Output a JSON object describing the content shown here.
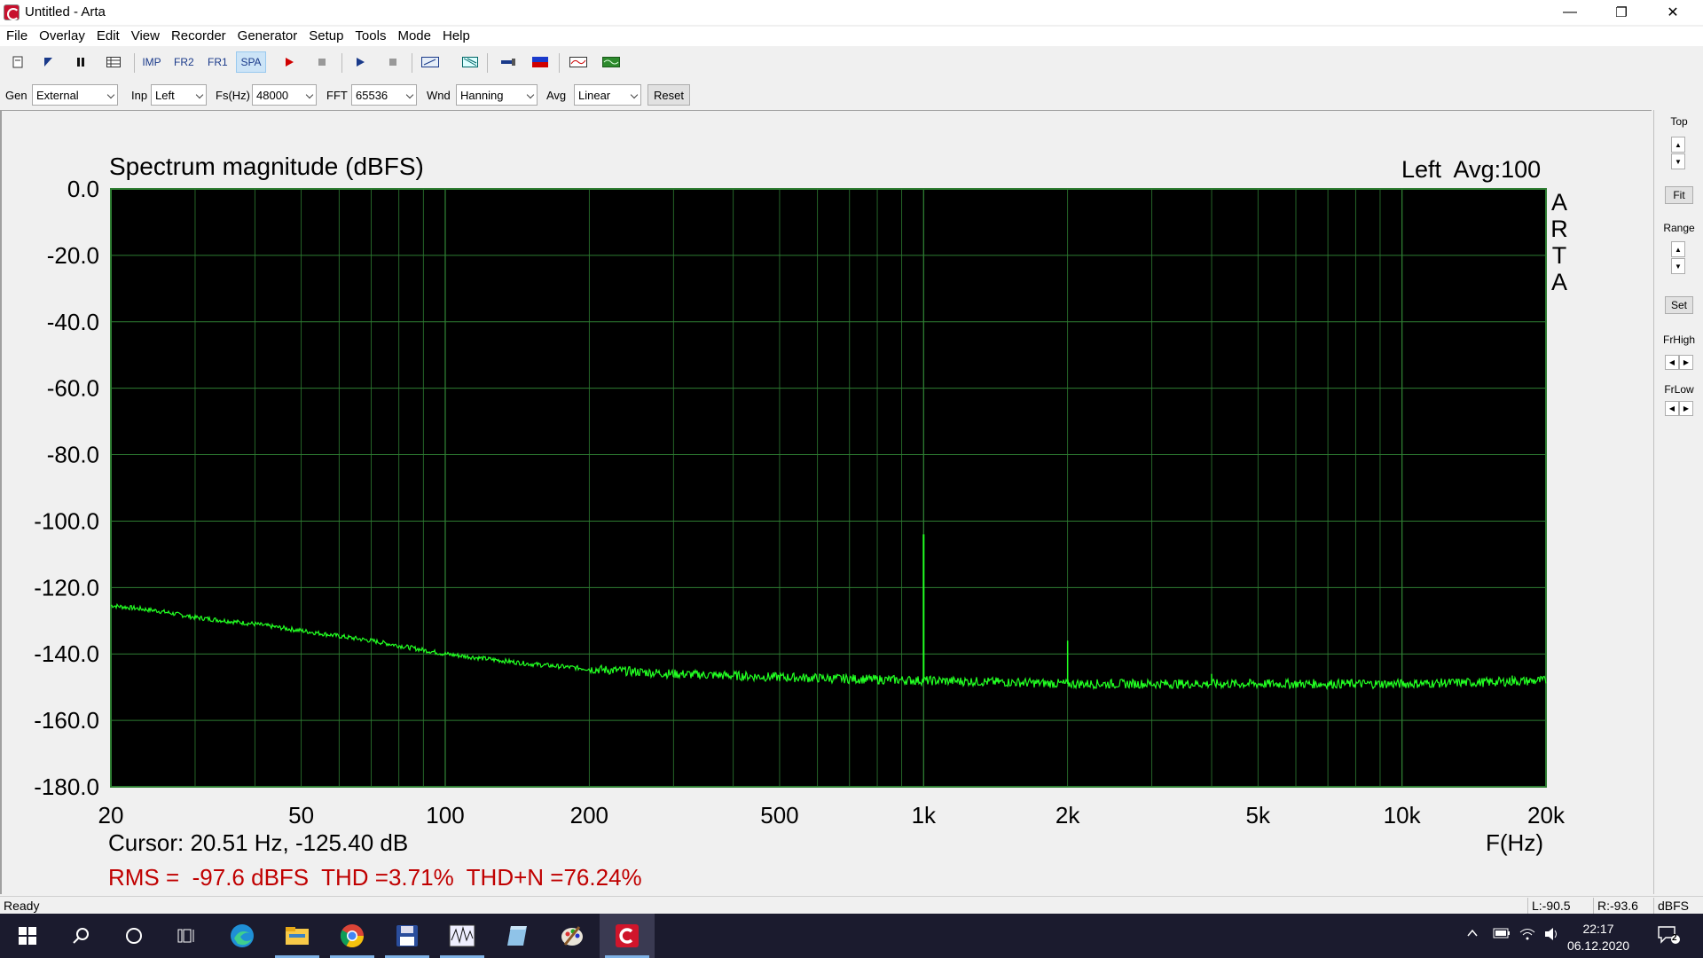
{
  "window": {
    "title": "Untitled - Arta",
    "minimize": "—",
    "restore": "❐",
    "close": "✕"
  },
  "menu": [
    "File",
    "Overlay",
    "Edit",
    "View",
    "Recorder",
    "Generator",
    "Setup",
    "Tools",
    "Mode",
    "Help"
  ],
  "toolbar": {
    "imp": "IMP",
    "fr2": "FR2",
    "fr1": "FR1",
    "spa": "SPA",
    "icons": [
      "new-file-icon",
      "open-icon",
      "pause-icon",
      "grid-icon",
      "record-icon",
      "stop-icon",
      "play-icon",
      "stop2-icon",
      "calib-icon",
      "scope-icon",
      "probe-icon",
      "meter-icon",
      "waveform-icon",
      "signal-icon"
    ]
  },
  "settings": {
    "gen_label": "Gen",
    "gen_value": "External",
    "inp_label": "Inp",
    "inp_value": "Left",
    "fs_label": "Fs(Hz)",
    "fs_value": "48000",
    "fft_label": "FFT",
    "fft_value": "65536",
    "wnd_label": "Wnd",
    "wnd_value": "Hanning",
    "avg_label": "Avg",
    "avg_value": "Linear",
    "reset": "Reset"
  },
  "plot": {
    "title": "Spectrum magnitude (dBFS)",
    "info": "Left  Avg:100",
    "arta": [
      "A",
      "R",
      "T",
      "A"
    ],
    "cursor": "Cursor: 20.51 Hz, -125.40 dB",
    "xunit": "F(Hz)",
    "rms": "RMS =  -97.6 dBFS  THD =3.71%  THD+N =76.24%",
    "background": "#000000",
    "grid_color": "#2e7d32",
    "trace_color": "#22ff22"
  },
  "chart_data": {
    "type": "line",
    "title": "Spectrum magnitude (dBFS)",
    "xlabel": "F(Hz)",
    "ylabel": "",
    "xscale": "log",
    "xlim": [
      20,
      20000
    ],
    "ylim": [
      -180,
      0
    ],
    "grid": true,
    "xticks": [
      20,
      50,
      100,
      200,
      500,
      1000,
      2000,
      5000,
      10000,
      20000
    ],
    "xtick_labels": [
      "20",
      "50",
      "100",
      "200",
      "500",
      "1k",
      "2k",
      "5k",
      "10k",
      "20k"
    ],
    "yticks": [
      0,
      -20,
      -40,
      -60,
      -80,
      -100,
      -120,
      -140,
      -160,
      -180
    ],
    "ytick_labels": [
      "0.0",
      "-20.0",
      "-40.0",
      "-60.0",
      "-80.0",
      "-100.0",
      "-120.0",
      "-140.0",
      "-160.0",
      "-180.0"
    ],
    "series": [
      {
        "x": [
          20,
          25,
          30,
          40,
          50,
          70,
          100,
          150,
          200,
          300,
          500,
          700,
          1000,
          1500,
          2000,
          3000,
          5000,
          7000,
          10000,
          15000,
          20000
        ],
        "y": [
          -125.4,
          -127,
          -129,
          -131,
          -133,
          -136,
          -140,
          -143,
          -144.5,
          -146,
          -147,
          -147.5,
          -148,
          -148.5,
          -149,
          -149,
          -149,
          -149,
          -149,
          -148.5,
          -148
        ]
      }
    ],
    "peaks": [
      {
        "x": 1000,
        "y": -104
      },
      {
        "x": 2000,
        "y": -136
      },
      {
        "x": 4000,
        "y": -146
      },
      {
        "x": 17000,
        "y": -146.5
      }
    ]
  },
  "right_panel": {
    "top": "Top",
    "fit": "Fit",
    "range": "Range",
    "set": "Set",
    "frhigh": "FrHigh",
    "frlow": "FrLow",
    "up": "▲",
    "down": "▼",
    "left": "◀",
    "right": "▶"
  },
  "status": {
    "ready": "Ready",
    "l": "L:-90.5",
    "r": "R:-93.6",
    "unit": "dBFS"
  },
  "taskbar": {
    "time": "22:17",
    "date": "06.12.2020",
    "notifications": "2"
  }
}
